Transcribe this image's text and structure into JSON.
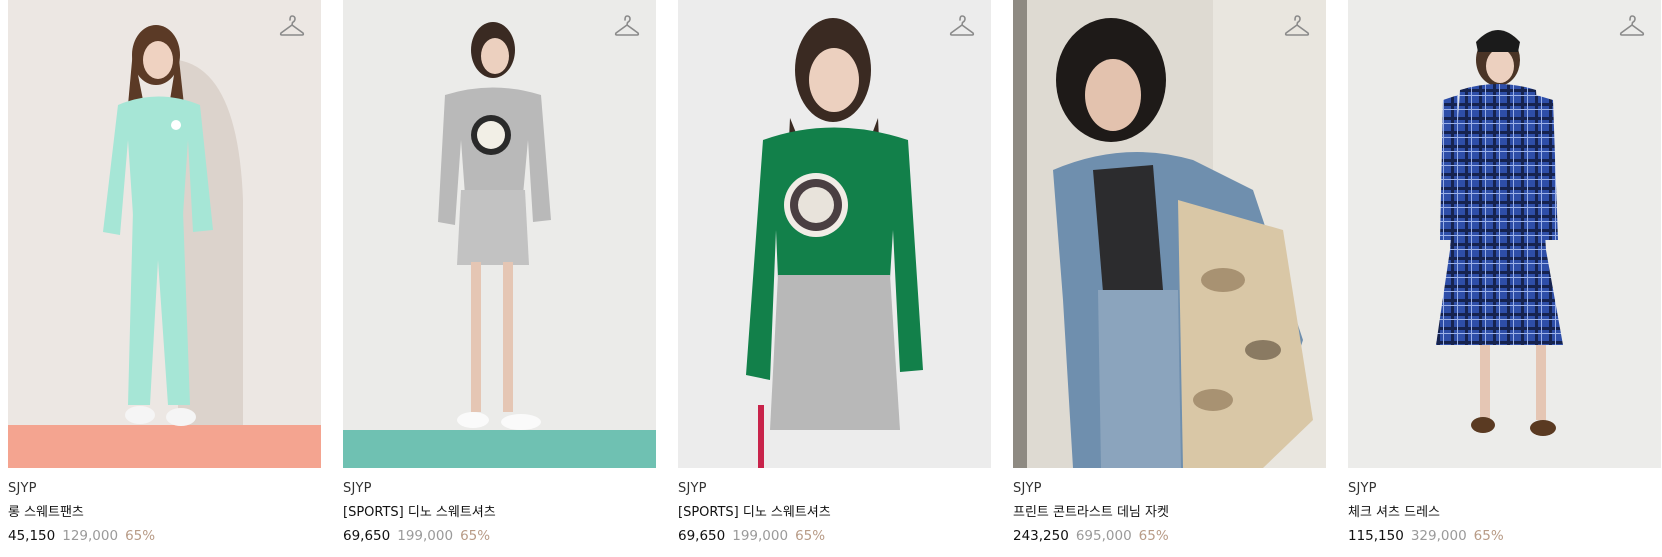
{
  "products": [
    {
      "brand": "SJYP",
      "name": "롱 스웨트팬츠",
      "sale_price": "45,150",
      "original_price": "129,000",
      "discount": "65%",
      "image_icon": "model-photo-mint-sweatsuit",
      "colors": {
        "bg": "#ece7e3",
        "floor": "#f4a490",
        "garment": "#a6e6d6",
        "hair": "#5b3a26"
      }
    },
    {
      "brand": "SJYP",
      "name": "[SPORTS] 디노 스웨트셔츠",
      "sale_price": "69,650",
      "original_price": "199,000",
      "discount": "65%",
      "image_icon": "model-photo-grey-sweatshirt",
      "colors": {
        "bg": "#ebebe9",
        "floor": "#6fc1b2",
        "garment": "#b9b9b9",
        "hair": "#3a2a22"
      }
    },
    {
      "brand": "SJYP",
      "name": "[SPORTS] 디노 스웨트셔츠",
      "sale_price": "69,650",
      "original_price": "199,000",
      "discount": "65%",
      "image_icon": "model-photo-green-sweatshirt",
      "colors": {
        "bg": "#ececec",
        "floor": "#ececec",
        "garment": "#12804a",
        "hair": "#3a2a22"
      }
    },
    {
      "brand": "SJYP",
      "name": "프린트 콘트라스트 데님 자켓",
      "sale_price": "243,250",
      "original_price": "695,000",
      "discount": "65%",
      "image_icon": "model-photo-denim-jacket",
      "colors": {
        "bg": "#dedad2",
        "floor": "#dedad2",
        "garment": "#6f8fae",
        "hair": "#1e1a18"
      }
    },
    {
      "brand": "SJYP",
      "name": "체크 셔츠 드레스",
      "sale_price": "115,150",
      "original_price": "329,000",
      "discount": "65%",
      "image_icon": "model-photo-check-dress",
      "colors": {
        "bg": "#ececea",
        "floor": "#ececea",
        "garment": "#2e4ea8",
        "hair": "#4a3426"
      }
    }
  ],
  "icons": {
    "wishlist": "hanger-icon"
  }
}
